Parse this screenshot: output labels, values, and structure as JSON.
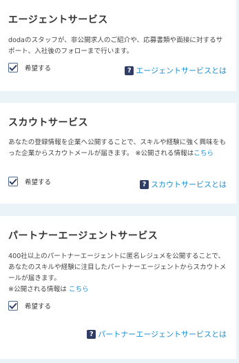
{
  "services": [
    {
      "title": "エージェントサービス",
      "description": "dodaのスタッフが、非公開求人のご紹介や、応募書類や面接に対するサポート、入社後のフォローまで行います。",
      "checkbox_label": "希望する",
      "checked": true,
      "help_link": "エージェントサービスとは"
    },
    {
      "title": "スカウトサービス",
      "description": "あなたの登録情報を企業へ公開することで、スキルや経験に強く興味をもった企業からスカウトメールが届きます。 ※公開される情報は",
      "description_link": "こちら",
      "checkbox_label": "希望する",
      "checked": true,
      "help_link": "スカウトサービスとは"
    },
    {
      "title": "パートナーエージェントサービス",
      "description": "400社以上のパートナーエージェントに匿名レジュメを公開することで、あなたのスキルや経験に注目したパートナーエージェントからスカウトメールが届きます。",
      "note": "※公開される情報は",
      "note_link": "こちら",
      "checkbox_label": "希望する",
      "checked": true,
      "help_link": "パートナーエージェントサービスとは"
    }
  ],
  "help_icon_glyph": "?",
  "colors": {
    "link": "#1a8fd1",
    "check": "#2f3d66",
    "background": "#eaf3f8"
  }
}
